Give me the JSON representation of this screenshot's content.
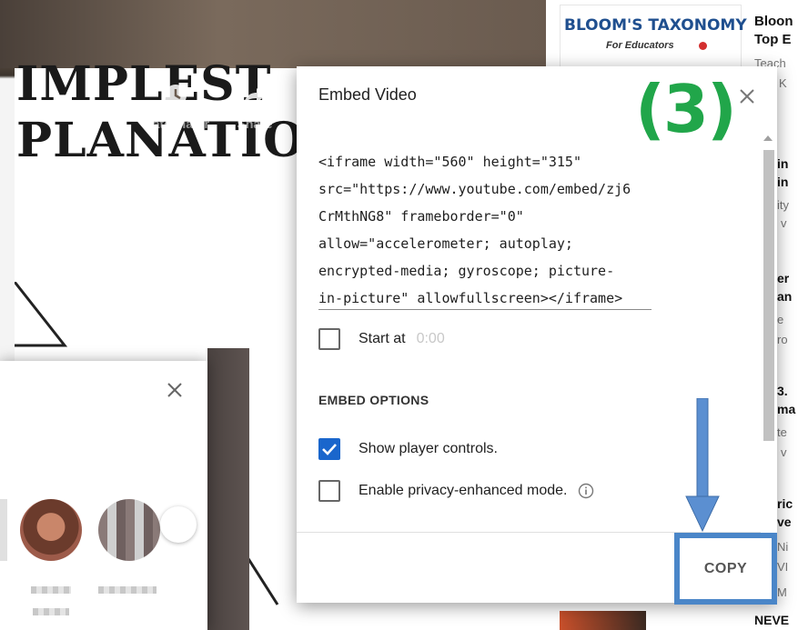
{
  "video": {
    "title_line_1": "IMPLEST",
    "title_line_2": "PLANATION",
    "watch_later_label": "Watch later",
    "share_label": "Share"
  },
  "sidebar": {
    "thumbnail_title": "BLOOM'S TAXONOMY",
    "thumbnail_subtitle": "For Educators",
    "video_title_line_1": "Bloon",
    "video_title_line_2": "Top E",
    "fragments": [
      "Teach",
      "K",
      "in",
      "in",
      "ity",
      "v",
      "er",
      "an",
      "e",
      "ro",
      "3.",
      "ma",
      "te",
      "v",
      "ric",
      "ve",
      "Ni",
      "VI",
      "M",
      "NEVE"
    ]
  },
  "embed_dialog": {
    "title": "Embed Video",
    "step_label": "(3)",
    "embed_code": "<iframe width=\"560\" height=\"315\"\nsrc=\"https://www.youtube.com/embed/zj6\nCrMthNG8\" frameborder=\"0\"\nallow=\"accelerometer; autoplay;\nencrypted-media; gyroscope; picture-\nin-picture\" allowfullscreen></iframe>",
    "start_at_label": "Start at",
    "start_at_value": "0:00",
    "options_heading": "EMBED OPTIONS",
    "show_controls_label": "Show player controls.",
    "show_controls_checked": true,
    "privacy_label": "Enable privacy-enhanced mode.",
    "privacy_checked": false,
    "copy_label": "COPY"
  },
  "annotation": {
    "step_color": "#21a64a",
    "highlight_color": "#4a86c8"
  },
  "colors": {
    "checkbox_checked": "#1a66cc"
  }
}
